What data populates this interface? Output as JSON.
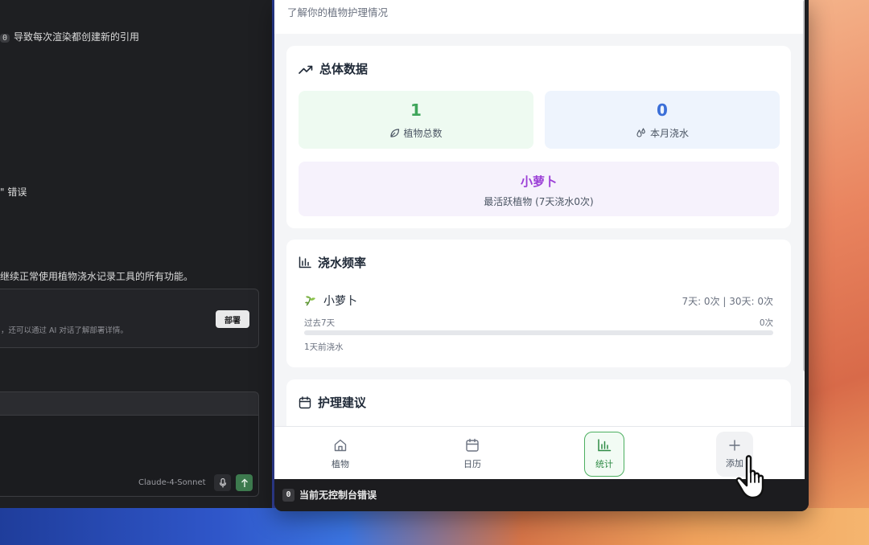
{
  "editor": {
    "line1_badge": "0",
    "line1_text": "导致每次渲染都创建新的引用",
    "line2_text": "\" 错误",
    "line3_text": "继续正常使用植物浇水记录工具的所有功能。",
    "deploy_note": "，还可以通过 AI 对话了解部署详情。",
    "deploy_button": "部署",
    "model_label": "Claude-4-Sonnet"
  },
  "app": {
    "subtitle": "了解你的植物护理情况",
    "overview": {
      "title": "总体数据",
      "total_plants_value": "1",
      "total_plants_label": "植物总数",
      "month_water_value": "0",
      "month_water_label": "本月浇水",
      "most_active_name": "小萝卜",
      "most_active_label": "最活跃植物 (7天浇水0次)"
    },
    "frequency": {
      "title": "浇水频率",
      "plant_name": "小萝卜",
      "counts": "7天: 0次 | 30天: 0次",
      "period_label": "过去7天",
      "period_value": "0次",
      "progress": 0,
      "last_watered": "1天前浇水"
    },
    "tips": {
      "title": "护理建议"
    },
    "nav": {
      "plants": "植物",
      "calendar": "日历",
      "stats": "统计",
      "add": "添加"
    }
  },
  "status": {
    "badge": "0",
    "text": "当前无控制台错误"
  },
  "colors": {
    "green": "#3ea55a",
    "blue": "#3b6fd8",
    "purple": "#9b3fd6",
    "stat_green_bg": "#eefaf1",
    "stat_blue_bg": "#eef4fd"
  }
}
